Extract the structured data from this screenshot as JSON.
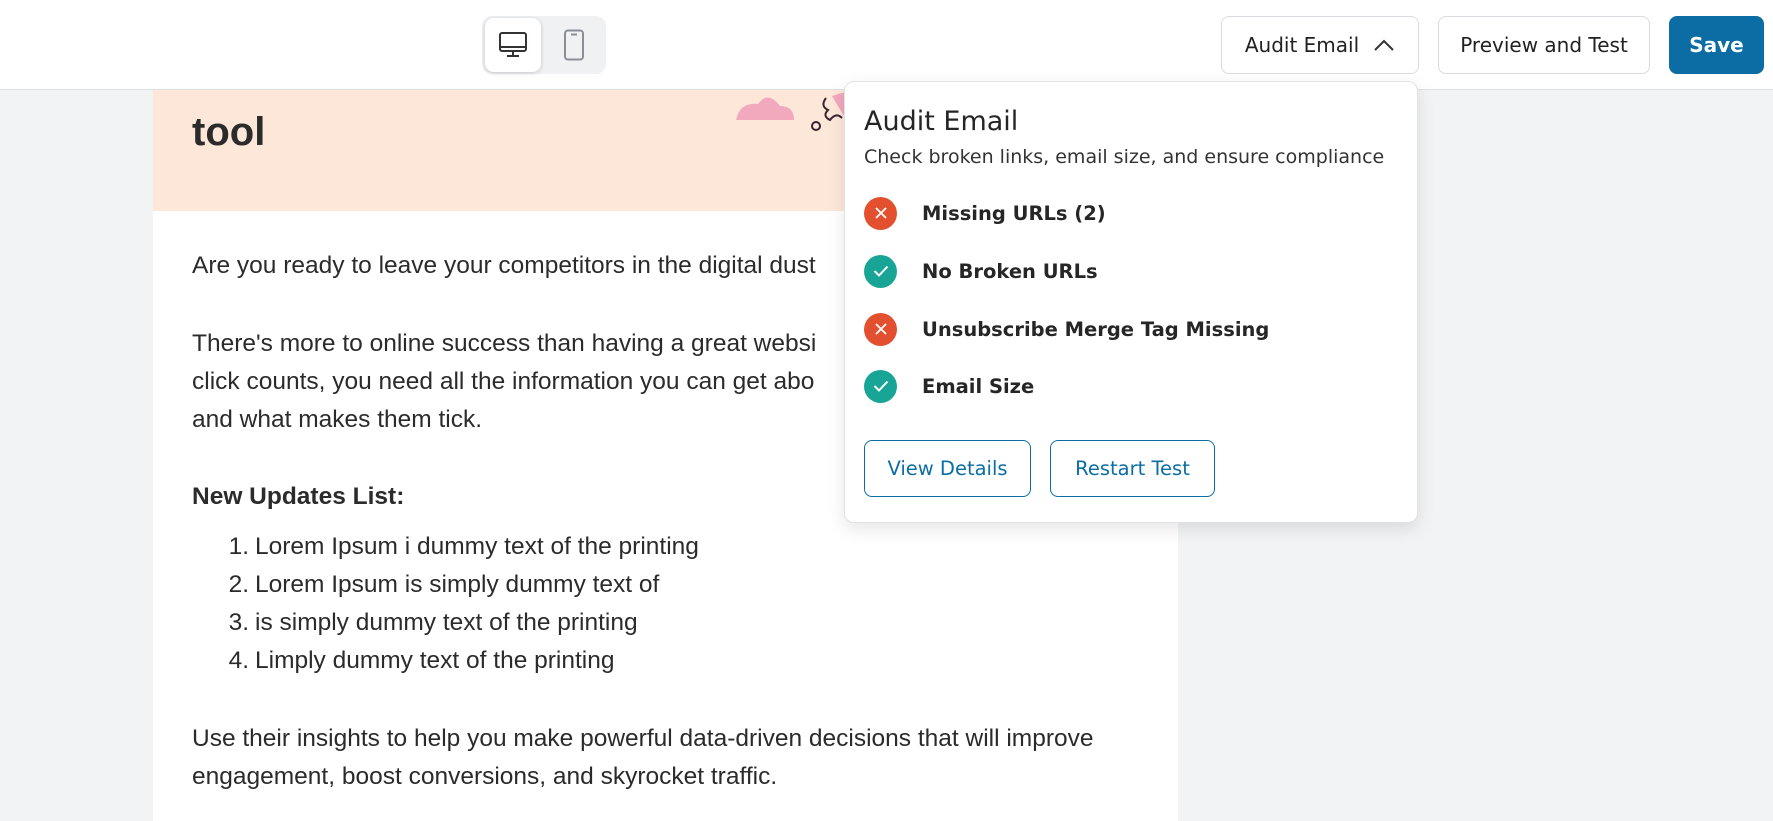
{
  "toolbar": {
    "devices": [
      "desktop-icon",
      "mobile-icon"
    ],
    "active_device": "desktop",
    "audit_label": "Audit Email",
    "preview_label": "Preview and Test",
    "save_label": "Save"
  },
  "email": {
    "hero_title": "tool",
    "intro": "Are you ready to leave your competitors in the digital dust",
    "para2_lines": [
      "There's more to online success than having a great websi",
      "click counts, you need all the information you can get abo",
      "and what makes them tick."
    ],
    "list_title": "New Updates List:",
    "list_items": [
      {
        "num": "1.",
        "text": "Lorem Ipsum i dummy text of the printing"
      },
      {
        "num": "2.",
        "text": "Lorem Ipsum is simply dummy text of"
      },
      {
        "num": "3.",
        "text": "is simply dummy text of the printing"
      },
      {
        "num": "4.",
        "text": "Limply dummy text of the printing"
      }
    ],
    "closing_lines": [
      "Use their insights to help you make powerful data-driven decisions that will improve",
      "engagement, boost conversions, and skyrocket traffic."
    ]
  },
  "audit": {
    "title": "Audit Email",
    "subtitle": "Check broken links, email size, and ensure compliance",
    "checks": [
      {
        "label": "Missing URLs (2)",
        "status": "fail"
      },
      {
        "label": "No Broken URLs",
        "status": "pass"
      },
      {
        "label": "Unsubscribe Merge Tag Missing",
        "status": "fail"
      },
      {
        "label": "Email Size",
        "status": "pass"
      }
    ],
    "view_details_label": "View Details",
    "restart_label": "Restart Test"
  },
  "colors": {
    "brand": "#0b6da3",
    "fail": "#e2502f",
    "pass": "#19a596",
    "hero_bg": "#fde7d9"
  }
}
